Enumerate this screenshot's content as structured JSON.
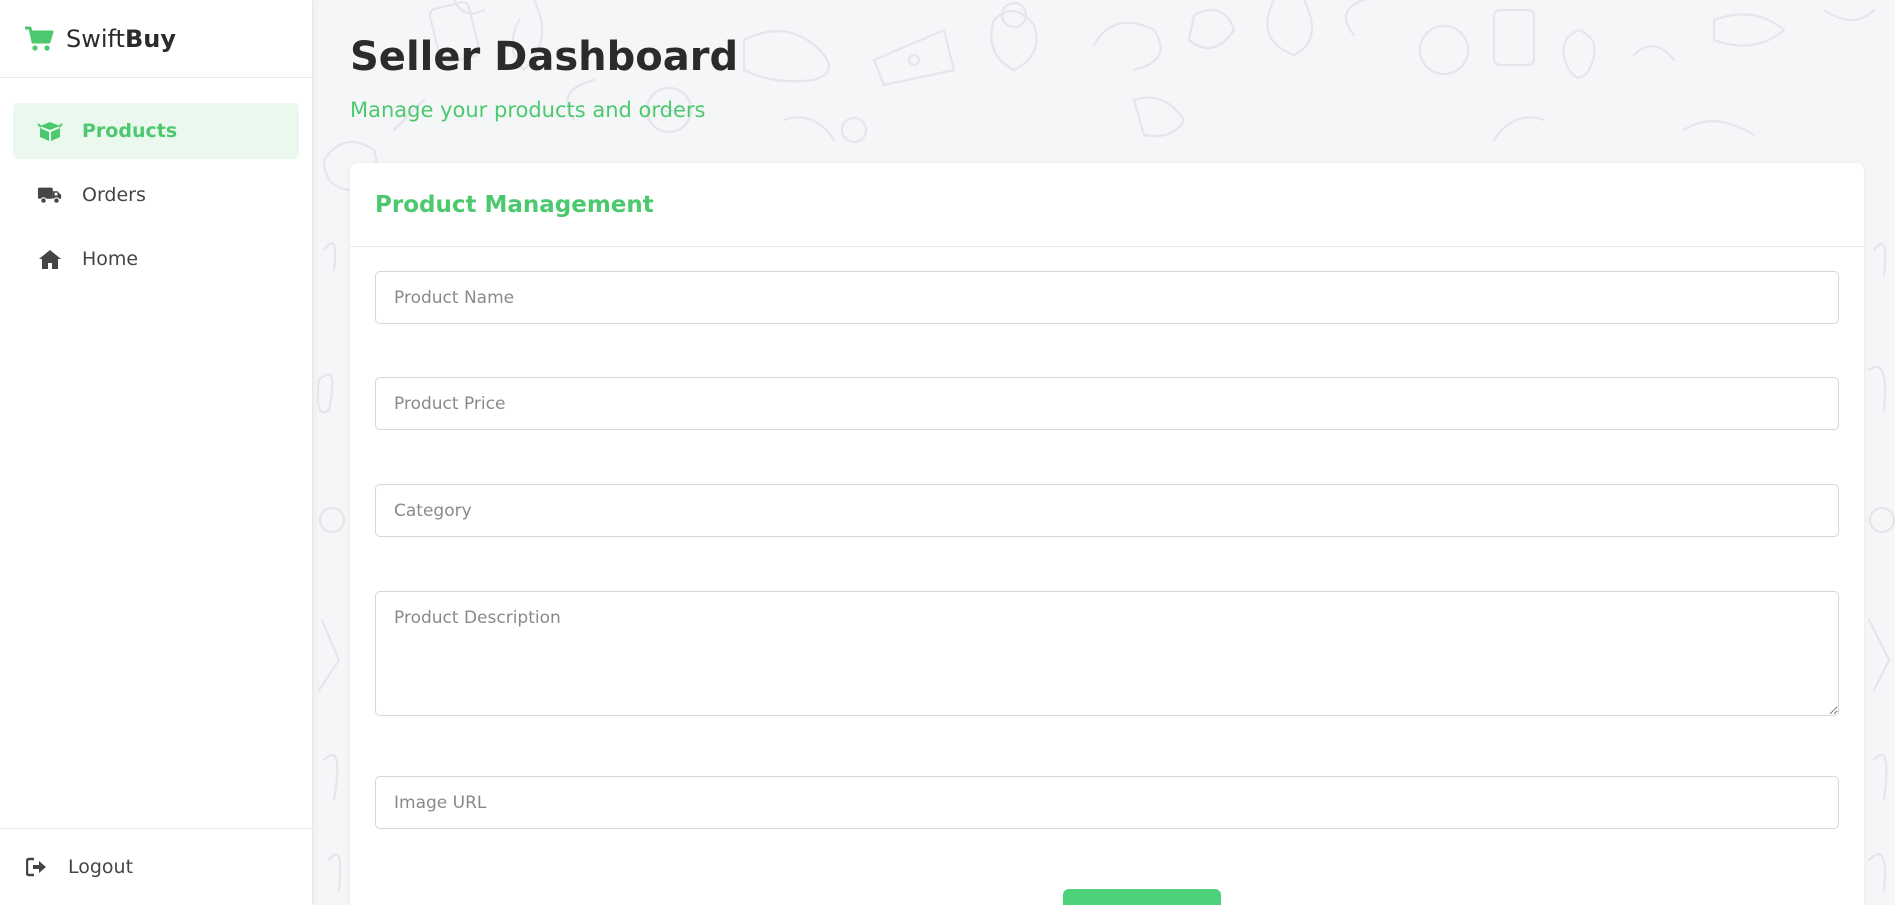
{
  "brand": {
    "name_regular": "Swift",
    "name_bold": "Buy",
    "accent": "#4cc96e",
    "icon": "shopping-cart-icon"
  },
  "sidebar": {
    "items": [
      {
        "label": "Products",
        "icon": "box-icon",
        "active": true
      },
      {
        "label": "Orders",
        "icon": "truck-icon",
        "active": false
      },
      {
        "label": "Home",
        "icon": "home-icon",
        "active": false
      }
    ],
    "logout": {
      "label": "Logout",
      "icon": "sign-out-icon"
    }
  },
  "header": {
    "title": "Seller Dashboard",
    "subtitle": "Manage your products and orders"
  },
  "card": {
    "title": "Product Management",
    "fields": {
      "name": {
        "placeholder": "Product Name",
        "value": ""
      },
      "price": {
        "placeholder": "Product Price",
        "value": ""
      },
      "category": {
        "placeholder": "Category",
        "value": ""
      },
      "description": {
        "placeholder": "Product Description",
        "value": ""
      },
      "image": {
        "placeholder": "Image URL",
        "value": ""
      }
    }
  },
  "colors": {
    "accent": "#4cc96e",
    "active_bg": "#eaf8ee",
    "button": "#4cd17a"
  }
}
